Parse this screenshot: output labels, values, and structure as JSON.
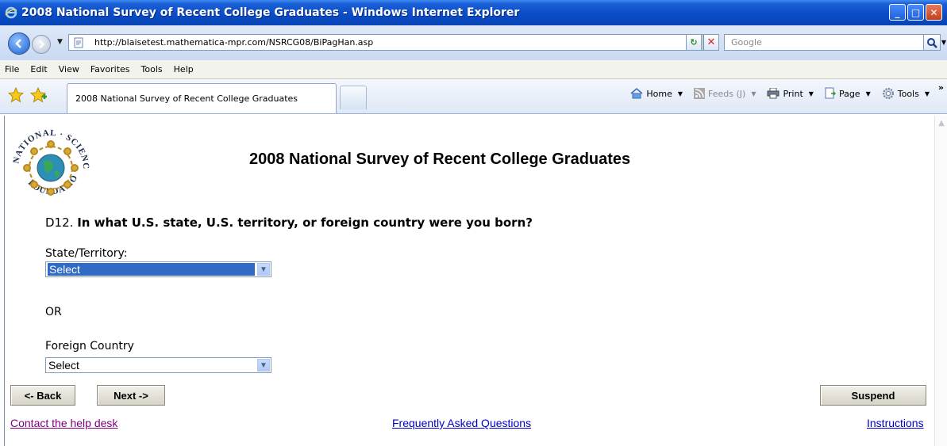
{
  "window": {
    "title": "2008 National Survey of Recent College Graduates - Windows Internet Explorer",
    "minimize": "_",
    "maximize": "□",
    "close": "✕"
  },
  "addressbar": {
    "url": "http://blaisetest.mathematica-mpr.com/NSRCG08/BiPagHan.asp",
    "search_placeholder": "Google"
  },
  "menu": [
    "File",
    "Edit",
    "View",
    "Favorites",
    "Tools",
    "Help"
  ],
  "tabs": [
    {
      "label": "2008 National Survey of Recent College Graduates"
    }
  ],
  "commandbar": {
    "home": "Home",
    "feeds": "Feeds (J)",
    "print": "Print",
    "page": "Page",
    "tools": "Tools"
  },
  "page": {
    "title": "2008 National Survey of Recent College Graduates",
    "logo_text": "NATIONAL SCIENCE FOUNDATION",
    "question_number": "D12.",
    "question_text": "In what U.S. state, U.S. territory, or foreign country were you born?",
    "state_label": "State/Territory:",
    "state_value": "Select",
    "or_label": "OR",
    "country_label": "Foreign Country",
    "country_value": "Select"
  },
  "buttons": {
    "back": "<- Back",
    "next": "Next ->",
    "suspend": "Suspend"
  },
  "links": {
    "help": "Contact the help desk",
    "faq": "Frequently Asked Questions",
    "instructions": "Instructions"
  },
  "colors": {
    "titlebar": "#0a4dc8",
    "select_highlight": "#316ac5",
    "visited_link": "#800080",
    "link": "#0000cc"
  }
}
